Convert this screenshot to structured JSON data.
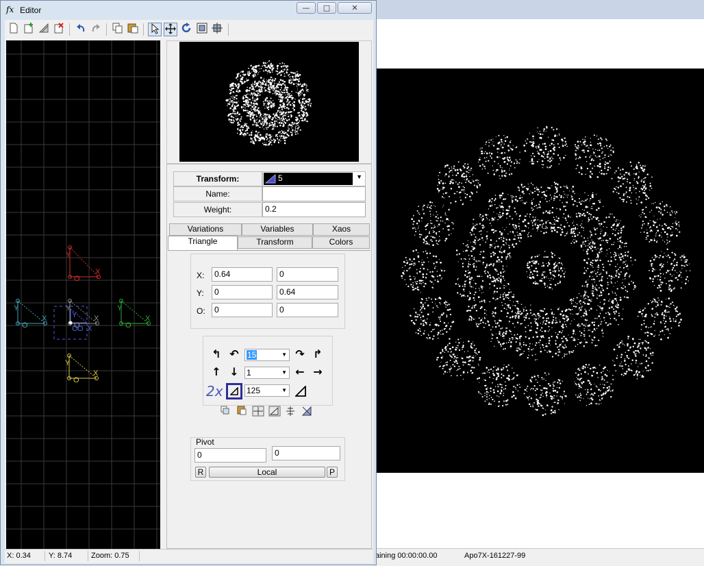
{
  "window": {
    "title": "Editor",
    "icon": "fx",
    "min": "—",
    "max": "□",
    "close": "✕"
  },
  "toolbar": {
    "buttons": [
      "new-transform-icon",
      "add-transform-icon",
      "duplicate-transform-icon",
      "delete-transform-icon",
      "undo-icon",
      "redo-icon",
      "copy-icon",
      "paste-icon",
      "select-mode-icon",
      "move-mode-icon",
      "rotate-mode-icon",
      "scale-mode-icon",
      "flip-icon"
    ]
  },
  "transform": {
    "label": "Transform:",
    "value": "5",
    "name_label": "Name:",
    "name_value": "",
    "weight_label": "Weight:",
    "weight_value": "0.2"
  },
  "tabs": {
    "row1": [
      "Variations",
      "Variables",
      "Xaos"
    ],
    "row2": [
      "Triangle",
      "Transform",
      "Colors"
    ],
    "active": "Triangle"
  },
  "coords": {
    "x_label": "X:",
    "x1": "0.64",
    "x2": "0",
    "y_label": "Y:",
    "y1": "0",
    "y2": "0.64",
    "o_label": "O:",
    "o1": "0",
    "o2": "0"
  },
  "controls": {
    "rotate_value": "15",
    "move_value": "1",
    "scale_value": "125",
    "scale_mult": "2x"
  },
  "pivot": {
    "label": "Pivot",
    "x": "0",
    "y": "0",
    "reset_btn": "R",
    "mode_btn": "Local",
    "pick_btn": "P"
  },
  "status": {
    "x": "X: 0.34",
    "y": "Y: 8.74",
    "zoom": "Zoom: 0.75"
  },
  "main_status": {
    "remaining": "aining 00:00:00.00",
    "name": "Apo7X-161227-99"
  },
  "grid_labels": {
    "red": [
      "Y",
      "O",
      "X"
    ],
    "cyan": [
      "Y",
      "O",
      "X"
    ],
    "blue": [
      "Y",
      "O",
      "O",
      "X",
      "Y"
    ],
    "grey": [
      "Y",
      "O",
      "X"
    ],
    "green": [
      "Y",
      "O",
      "X"
    ],
    "yellow": [
      "Y",
      "O",
      "X"
    ]
  },
  "colors": {
    "red": "#d83030",
    "cyan": "#40a8b8",
    "blue": "#5060e0",
    "grey": "#909090",
    "green": "#30b030",
    "yellow": "#d8c840",
    "accent": "#2e2e9a"
  }
}
